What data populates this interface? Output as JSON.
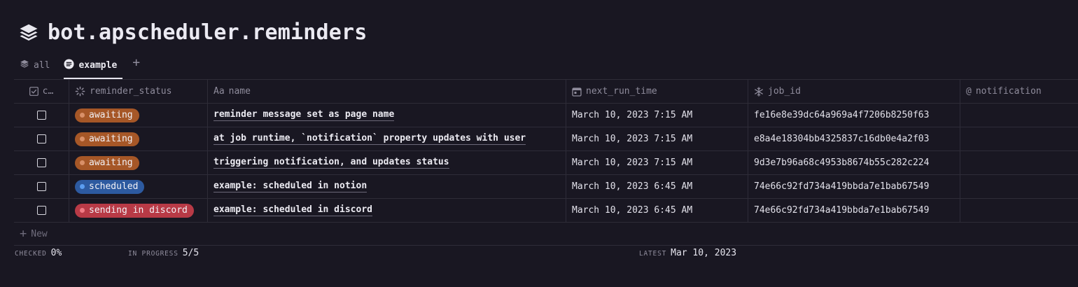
{
  "page": {
    "title": "bot.apscheduler.reminders"
  },
  "views": {
    "tabs": [
      {
        "label": "all"
      },
      {
        "label": "example"
      }
    ],
    "add_icon": "plus-icon"
  },
  "table": {
    "columns": [
      {
        "label": "c…",
        "icon": "checkbox-icon"
      },
      {
        "label": "reminder_status",
        "icon": "status-icon"
      },
      {
        "label": "name",
        "icon": "text-aa-icon",
        "icon_text": "Aa"
      },
      {
        "label": "next_run_time",
        "icon": "calendar-icon"
      },
      {
        "label": "job_id",
        "icon": "snowflake-icon"
      },
      {
        "label": "notification",
        "icon": "at-icon",
        "icon_text": "@"
      }
    ],
    "rows": [
      {
        "status": "awaiting",
        "status_color": "#a65727",
        "status_dot": "#d99068",
        "name": "reminder message set as page name",
        "next_run_time": "March 10, 2023 7:15 AM",
        "job_id": "fe16e8e39dc64a969a4f7206b8250f63",
        "notification": ""
      },
      {
        "status": "awaiting",
        "status_color": "#a65727",
        "status_dot": "#d99068",
        "name": "at job runtime, `notification` property updates with user",
        "next_run_time": "March 10, 2023 7:15 AM",
        "job_id": "e8a4e18304bb4325837c16db0e4a2f03",
        "notification": ""
      },
      {
        "status": "awaiting",
        "status_color": "#a65727",
        "status_dot": "#d99068",
        "name": "triggering notification, and updates status",
        "next_run_time": "March 10, 2023 7:15 AM",
        "job_id": "9d3e7b96a68c4953b8674b55c282c224",
        "notification": ""
      },
      {
        "status": "scheduled",
        "status_color": "#2d5aa0",
        "status_dot": "#5b9df0",
        "name": "example: scheduled in notion",
        "next_run_time": "March 10, 2023 6:45 AM",
        "job_id": "74e66c92fd734a419bbda7e1bab67549",
        "notification": ""
      },
      {
        "status": "sending in discord",
        "status_color": "#b83a46",
        "status_dot": "#f07a84",
        "name": "example: scheduled in discord",
        "next_run_time": "March 10, 2023 6:45 AM",
        "job_id": "74e66c92fd734a419bbda7e1bab67549",
        "notification": ""
      }
    ],
    "new_label": "New"
  },
  "footer": {
    "checked_label": "CHECKED",
    "checked_value": "0%",
    "progress_label": "IN PROGRESS",
    "progress_value": "5/5",
    "latest_label": "LATEST",
    "latest_value": "Mar 10, 2023"
  }
}
